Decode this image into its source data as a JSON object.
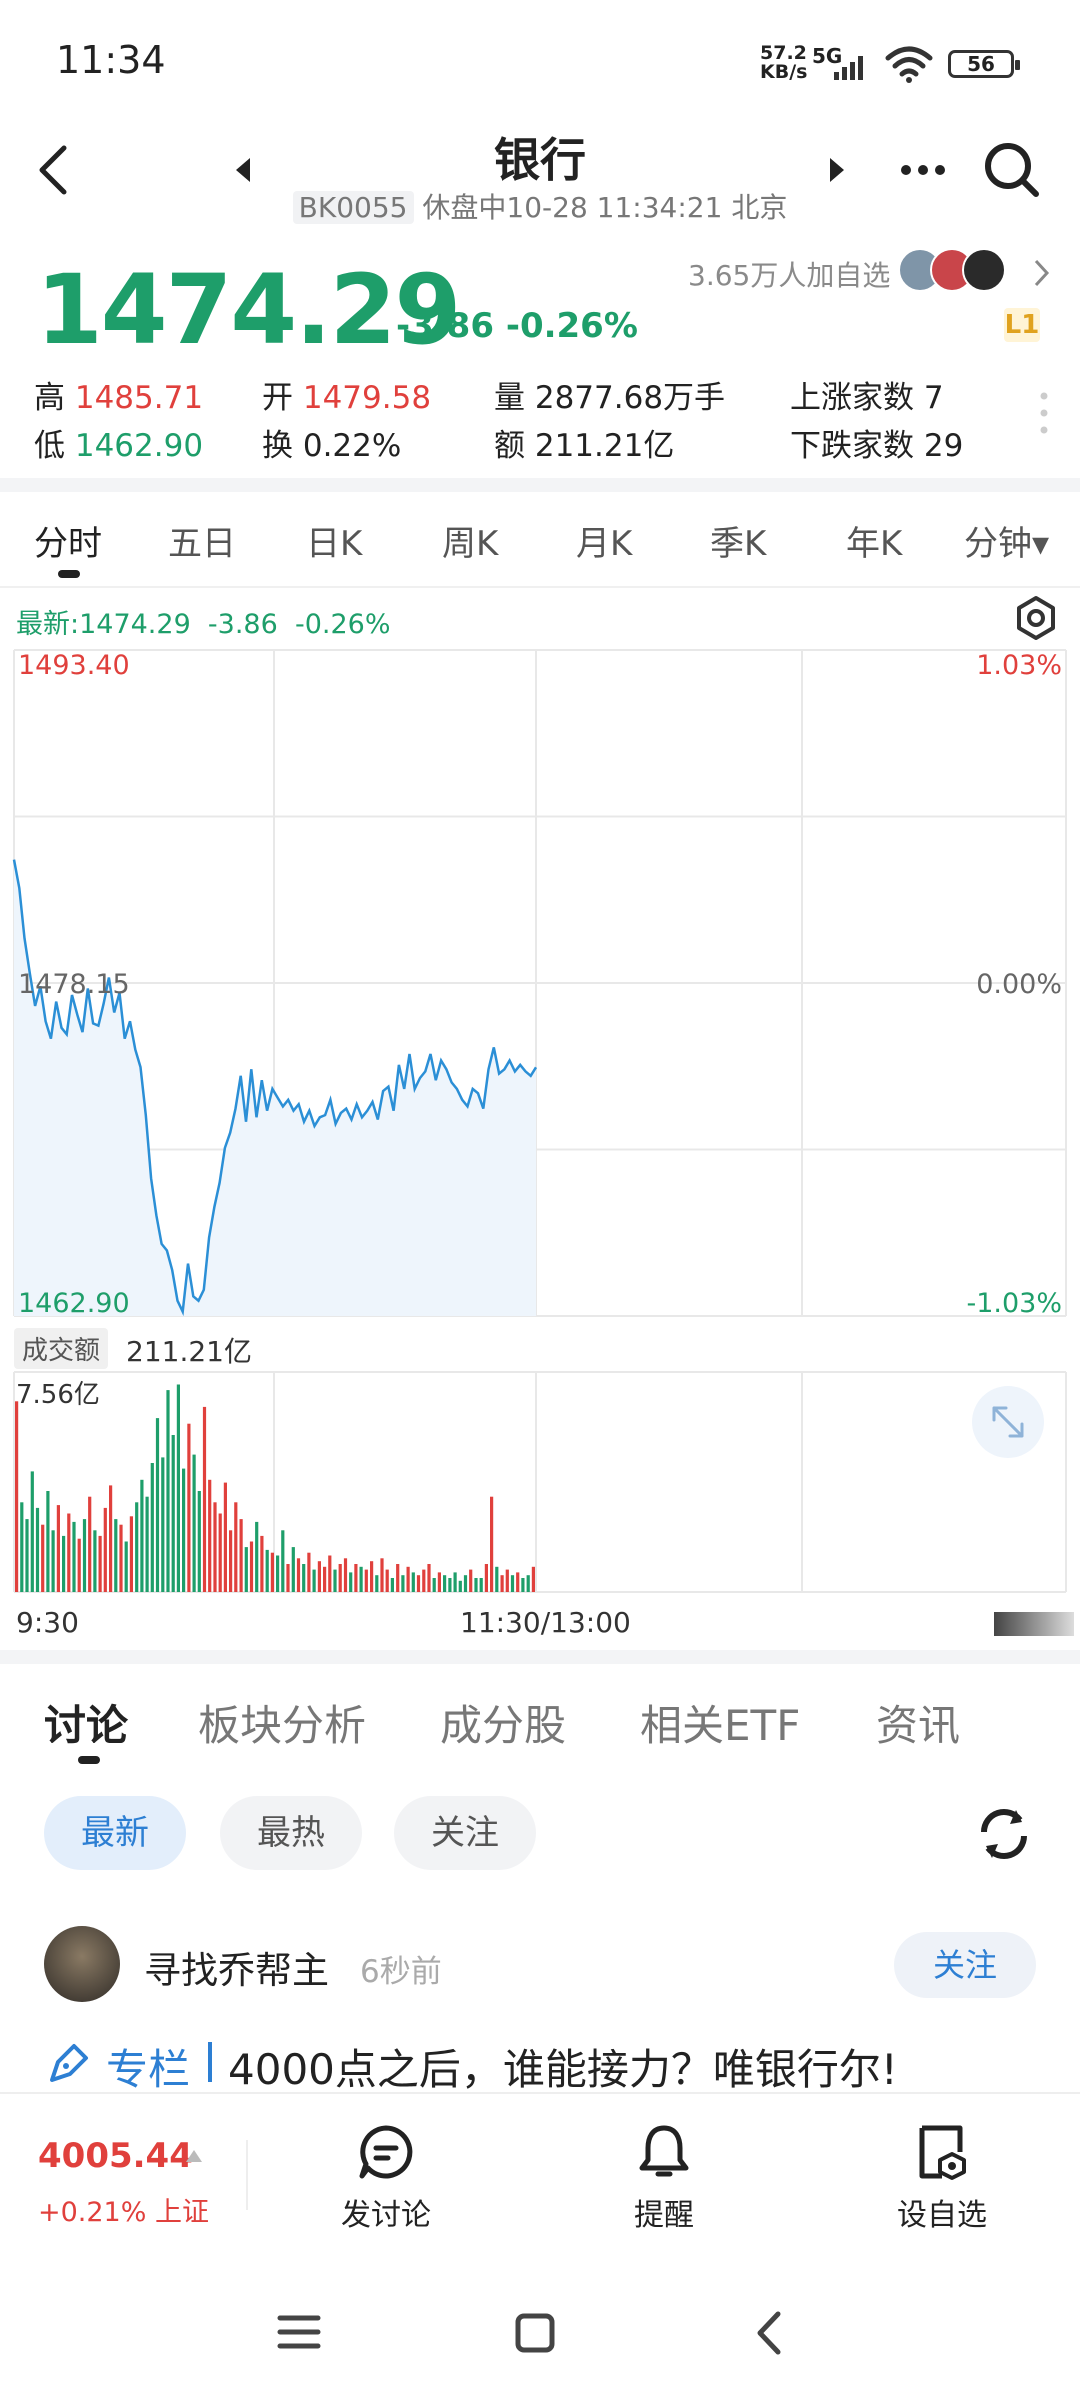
{
  "status_bar": {
    "time": "11:34",
    "net_speed_value": "57.2",
    "net_speed_unit": "KB/s",
    "network": "5G",
    "battery": "56"
  },
  "header": {
    "title": "银行",
    "code": "BK0055",
    "status": "休盘中10-28 11:34:21 北京"
  },
  "quote": {
    "price": "1474.29",
    "change": "-3.86",
    "change_pct": "-0.26%",
    "followers": "3.65万人加自选",
    "level_badge": "L1",
    "high_label": "高",
    "high": "1485.71",
    "low_label": "低",
    "low": "1462.90",
    "open_label": "开",
    "open": "1479.58",
    "turnover_label": "换",
    "turnover": "0.22%",
    "volume_label": "量",
    "volume": "2877.68万手",
    "amount_label": "额",
    "amount": "211.21亿",
    "up_count_label": "上涨家数",
    "up_count": "7",
    "down_count_label": "下跌家数",
    "down_count": "29"
  },
  "chart_tabs": [
    "分时",
    "五日",
    "日K",
    "周K",
    "月K",
    "季K",
    "年K",
    "分钟▾"
  ],
  "chart_tabs_active": 0,
  "chart_info": {
    "latest": "最新:1474.29",
    "change": "-3.86",
    "change_pct": "-0.26%",
    "volume_tag": "成交额",
    "volume_total": "211.21亿",
    "volume_max": "7.56亿",
    "time_start": "9:30",
    "time_mid": "11:30/13:00"
  },
  "chart_data": {
    "type": "line",
    "title": "",
    "y_left_ticks": [
      "1493.40",
      "1478.15",
      "1462.90"
    ],
    "y_right_ticks": [
      "1.03%",
      "0.00%",
      "-1.03%"
    ],
    "ylim": [
      1462.9,
      1493.4
    ],
    "x_labels": [
      "9:30",
      "11:30/13:00"
    ],
    "price_series": [
      1483.8,
      1482.5,
      1480.2,
      1478.6,
      1477.1,
      1478.0,
      1476.4,
      1475.6,
      1477.3,
      1476.1,
      1475.8,
      1477.6,
      1476.7,
      1475.9,
      1477.9,
      1476.3,
      1476.2,
      1477.2,
      1478.4,
      1476.8,
      1477.7,
      1475.6,
      1476.4,
      1475.1,
      1474.3,
      1472.1,
      1469.2,
      1467.5,
      1466.2,
      1465.9,
      1465.0,
      1463.6,
      1463.1,
      1465.3,
      1463.8,
      1463.6,
      1464.1,
      1466.5,
      1467.9,
      1469.0,
      1470.6,
      1471.3,
      1472.4,
      1473.9,
      1471.8,
      1474.2,
      1472.0,
      1473.7,
      1472.3,
      1473.3,
      1472.9,
      1472.5,
      1472.8,
      1472.3,
      1472.6,
      1471.8,
      1472.3,
      1471.6,
      1472.0,
      1472.1,
      1472.8,
      1471.7,
      1472.2,
      1472.4,
      1471.9,
      1472.6,
      1472.0,
      1472.3,
      1472.7,
      1471.9,
      1473.2,
      1473.4,
      1472.3,
      1474.4,
      1473.3,
      1474.9,
      1473.3,
      1473.8,
      1474.1,
      1474.9,
      1473.7,
      1474.6,
      1474.2,
      1473.6,
      1473.3,
      1472.8,
      1472.5,
      1473.3,
      1473.1,
      1472.4,
      1474.2,
      1475.2,
      1474.0,
      1474.2,
      1474.6,
      1474.1,
      1474.4,
      1474.1,
      1473.9,
      1474.29
    ],
    "volume_series": [
      {
        "v": 6.8,
        "d": "up"
      },
      {
        "v": 3.2,
        "d": "down"
      },
      {
        "v": 2.6,
        "d": "down"
      },
      {
        "v": 4.3,
        "d": "down"
      },
      {
        "v": 3.0,
        "d": "down"
      },
      {
        "v": 2.4,
        "d": "up"
      },
      {
        "v": 3.6,
        "d": "down"
      },
      {
        "v": 2.2,
        "d": "down"
      },
      {
        "v": 3.1,
        "d": "up"
      },
      {
        "v": 2.0,
        "d": "down"
      },
      {
        "v": 2.8,
        "d": "up"
      },
      {
        "v": 2.5,
        "d": "down"
      },
      {
        "v": 1.9,
        "d": "up"
      },
      {
        "v": 2.6,
        "d": "down"
      },
      {
        "v": 3.4,
        "d": "up"
      },
      {
        "v": 2.2,
        "d": "down"
      },
      {
        "v": 2.0,
        "d": "up"
      },
      {
        "v": 3.0,
        "d": "up"
      },
      {
        "v": 3.8,
        "d": "up"
      },
      {
        "v": 2.6,
        "d": "down"
      },
      {
        "v": 2.4,
        "d": "up"
      },
      {
        "v": 1.8,
        "d": "down"
      },
      {
        "v": 2.7,
        "d": "up"
      },
      {
        "v": 3.2,
        "d": "down"
      },
      {
        "v": 4.0,
        "d": "down"
      },
      {
        "v": 3.4,
        "d": "down"
      },
      {
        "v": 4.6,
        "d": "down"
      },
      {
        "v": 6.2,
        "d": "down"
      },
      {
        "v": 4.8,
        "d": "down"
      },
      {
        "v": 7.2,
        "d": "down"
      },
      {
        "v": 5.6,
        "d": "down"
      },
      {
        "v": 7.4,
        "d": "down"
      },
      {
        "v": 4.4,
        "d": "down"
      },
      {
        "v": 6.0,
        "d": "up"
      },
      {
        "v": 4.9,
        "d": "down"
      },
      {
        "v": 3.6,
        "d": "down"
      },
      {
        "v": 6.6,
        "d": "up"
      },
      {
        "v": 4.0,
        "d": "up"
      },
      {
        "v": 3.2,
        "d": "up"
      },
      {
        "v": 2.8,
        "d": "up"
      },
      {
        "v": 3.9,
        "d": "up"
      },
      {
        "v": 2.2,
        "d": "up"
      },
      {
        "v": 3.2,
        "d": "up"
      },
      {
        "v": 2.6,
        "d": "up"
      },
      {
        "v": 1.6,
        "d": "down"
      },
      {
        "v": 1.8,
        "d": "up"
      },
      {
        "v": 2.5,
        "d": "down"
      },
      {
        "v": 2.0,
        "d": "up"
      },
      {
        "v": 1.5,
        "d": "down"
      },
      {
        "v": 1.4,
        "d": "up"
      },
      {
        "v": 1.3,
        "d": "down"
      },
      {
        "v": 2.2,
        "d": "down"
      },
      {
        "v": 1.0,
        "d": "up"
      },
      {
        "v": 1.6,
        "d": "down"
      },
      {
        "v": 1.2,
        "d": "up"
      },
      {
        "v": 1.0,
        "d": "down"
      },
      {
        "v": 1.4,
        "d": "up"
      },
      {
        "v": 0.8,
        "d": "down"
      },
      {
        "v": 1.1,
        "d": "up"
      },
      {
        "v": 0.9,
        "d": "up"
      },
      {
        "v": 1.3,
        "d": "up"
      },
      {
        "v": 0.8,
        "d": "down"
      },
      {
        "v": 1.0,
        "d": "up"
      },
      {
        "v": 1.2,
        "d": "up"
      },
      {
        "v": 0.7,
        "d": "down"
      },
      {
        "v": 1.0,
        "d": "up"
      },
      {
        "v": 0.9,
        "d": "down"
      },
      {
        "v": 0.8,
        "d": "up"
      },
      {
        "v": 1.1,
        "d": "up"
      },
      {
        "v": 0.6,
        "d": "down"
      },
      {
        "v": 1.2,
        "d": "up"
      },
      {
        "v": 0.8,
        "d": "up"
      },
      {
        "v": 0.5,
        "d": "down"
      },
      {
        "v": 1.0,
        "d": "up"
      },
      {
        "v": 0.6,
        "d": "down"
      },
      {
        "v": 0.9,
        "d": "up"
      },
      {
        "v": 0.7,
        "d": "down"
      },
      {
        "v": 0.6,
        "d": "up"
      },
      {
        "v": 0.8,
        "d": "up"
      },
      {
        "v": 1.0,
        "d": "up"
      },
      {
        "v": 0.5,
        "d": "down"
      },
      {
        "v": 0.7,
        "d": "up"
      },
      {
        "v": 0.6,
        "d": "down"
      },
      {
        "v": 0.5,
        "d": "down"
      },
      {
        "v": 0.7,
        "d": "down"
      },
      {
        "v": 0.4,
        "d": "down"
      },
      {
        "v": 0.6,
        "d": "down"
      },
      {
        "v": 0.8,
        "d": "up"
      },
      {
        "v": 0.5,
        "d": "down"
      },
      {
        "v": 0.5,
        "d": "down"
      },
      {
        "v": 1.0,
        "d": "up"
      },
      {
        "v": 3.4,
        "d": "up"
      },
      {
        "v": 0.9,
        "d": "down"
      },
      {
        "v": 0.6,
        "d": "up"
      },
      {
        "v": 0.8,
        "d": "up"
      },
      {
        "v": 0.6,
        "d": "down"
      },
      {
        "v": 0.7,
        "d": "up"
      },
      {
        "v": 0.5,
        "d": "down"
      },
      {
        "v": 0.6,
        "d": "down"
      },
      {
        "v": 0.9,
        "d": "up"
      }
    ],
    "colors": {
      "line": "#2b8fd6",
      "fill": "#eef5fc",
      "up": "#e0403c",
      "down": "#1e9e6a",
      "grid": "#e8e8e8"
    }
  },
  "content_tabs": [
    "讨论",
    "板块分析",
    "成分股",
    "相关ETF",
    "资讯"
  ],
  "content_tabs_active": 0,
  "filters": [
    "最新",
    "最热",
    "关注"
  ],
  "filters_active": 0,
  "post": {
    "author": "寻找乔帮主",
    "time": "6秒前",
    "follow_label": "关注",
    "column_tag": "专栏",
    "title": "4000点之后，谁能接力？唯银行尔!"
  },
  "footer": {
    "index_value": "4005.44",
    "index_change": "+0.21%",
    "index_name": "上证",
    "discuss_label": "发讨论",
    "remind_label": "提醒",
    "watchlist_label": "设自选"
  }
}
